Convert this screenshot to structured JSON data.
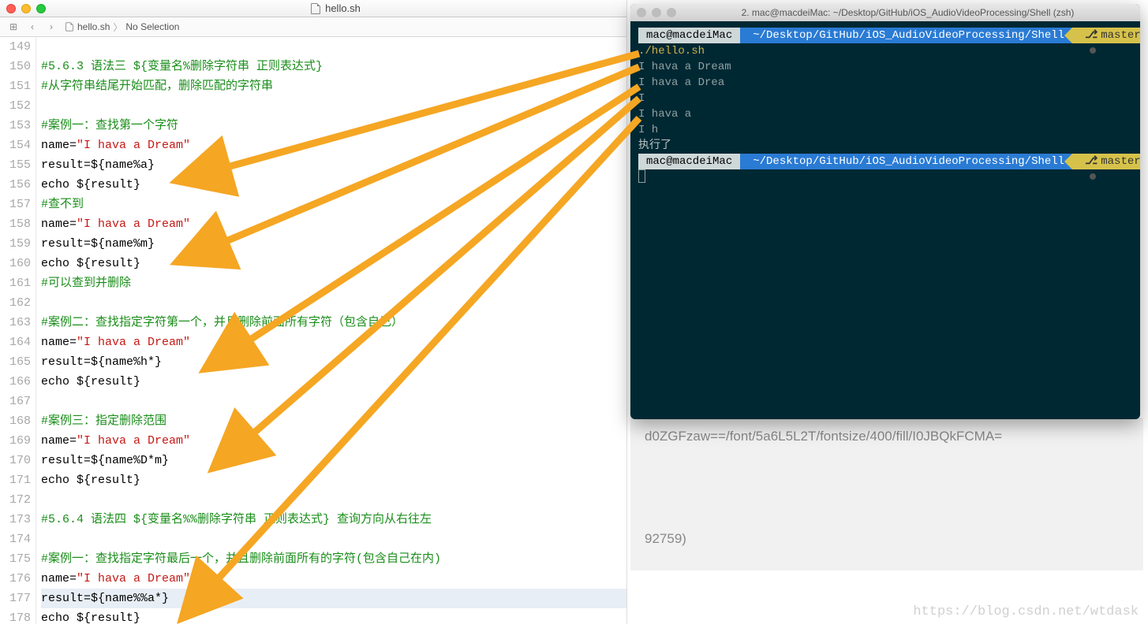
{
  "editor": {
    "window_title": "hello.sh",
    "toolbar": {
      "grid_icon": "⊞",
      "back_icon": "‹",
      "fwd_icon": "›",
      "crumb_file": "hello.sh",
      "crumb_sel": "No Selection"
    },
    "first_line_no": 149,
    "lines": [
      {
        "n": 149,
        "cls": "",
        "text": ""
      },
      {
        "n": 150,
        "cls": "comment",
        "text": "#5.6.3 语法三 ${变量名%删除字符串 正则表达式}"
      },
      {
        "n": 151,
        "cls": "comment",
        "text": "#从字符串结尾开始匹配，删除匹配的字符串"
      },
      {
        "n": 152,
        "cls": "",
        "text": ""
      },
      {
        "n": 153,
        "cls": "comment",
        "text": "#案例一：查找第一个字符"
      },
      {
        "n": 154,
        "cls": "",
        "html": "name=<span class='string'>\"I hava a Dream\"</span>"
      },
      {
        "n": 155,
        "cls": "",
        "text": "result=${name%a}"
      },
      {
        "n": 156,
        "cls": "",
        "text": "echo ${result}"
      },
      {
        "n": 157,
        "cls": "comment",
        "text": "#查不到"
      },
      {
        "n": 158,
        "cls": "",
        "html": "name=<span class='string'>\"I hava a Dream\"</span>"
      },
      {
        "n": 159,
        "cls": "",
        "text": "result=${name%m}"
      },
      {
        "n": 160,
        "cls": "",
        "text": "echo ${result}"
      },
      {
        "n": 161,
        "cls": "comment",
        "text": "#可以查到并删除"
      },
      {
        "n": 162,
        "cls": "",
        "text": ""
      },
      {
        "n": 163,
        "cls": "comment",
        "text": "#案例二：查找指定字符第一个，并且删除前面所有字符（包含自己）"
      },
      {
        "n": 164,
        "cls": "",
        "html": "name=<span class='string'>\"I hava a Dream\"</span>"
      },
      {
        "n": 165,
        "cls": "",
        "text": "result=${name%h*}"
      },
      {
        "n": 166,
        "cls": "",
        "text": "echo ${result}"
      },
      {
        "n": 167,
        "cls": "",
        "text": ""
      },
      {
        "n": 168,
        "cls": "comment",
        "text": "#案例三：指定删除范围"
      },
      {
        "n": 169,
        "cls": "",
        "html": "name=<span class='string'>\"I hava a Dream\"</span>"
      },
      {
        "n": 170,
        "cls": "",
        "text": "result=${name%D*m}"
      },
      {
        "n": 171,
        "cls": "",
        "text": "echo ${result}"
      },
      {
        "n": 172,
        "cls": "",
        "text": ""
      },
      {
        "n": 173,
        "cls": "comment",
        "text": "#5.6.4 语法四 ${变量名%%删除字符串 正则表达式} 查询方向从右往左"
      },
      {
        "n": 174,
        "cls": "",
        "text": ""
      },
      {
        "n": 175,
        "cls": "comment",
        "text": "#案例一：查找指定字符最后一个，并且删除前面所有的字符(包含自己在内)"
      },
      {
        "n": 176,
        "cls": "",
        "html": "name=<span class='string'>\"I hava a Dream\"</span>"
      },
      {
        "n": 177,
        "cls": "hl",
        "text": "result=${name%%a*}"
      },
      {
        "n": 178,
        "cls": "",
        "text": "echo ${result}"
      }
    ]
  },
  "terminal": {
    "title": "2. mac@macdeiMac: ~/Desktop/GitHub/iOS_AudioVideoProcessing/Shell (zsh)",
    "host": "mac@macdeiMac",
    "path": "~/Desktop/GitHub/iOS_AudioVideoProcessing/Shell",
    "git_branch": "master",
    "output": [
      "./hello.sh",
      "I hava a Dream",
      "I hava a Drea",
      "I",
      "I hava a",
      "I h",
      "执行了"
    ]
  },
  "background": {
    "line1": "d0ZGFzaw==/font/5a6L5L2T/fontsize/400/fill/I0JBQkFCMA=",
    "line2": "92759)"
  },
  "watermark": "https://blog.csdn.net/wtdask"
}
